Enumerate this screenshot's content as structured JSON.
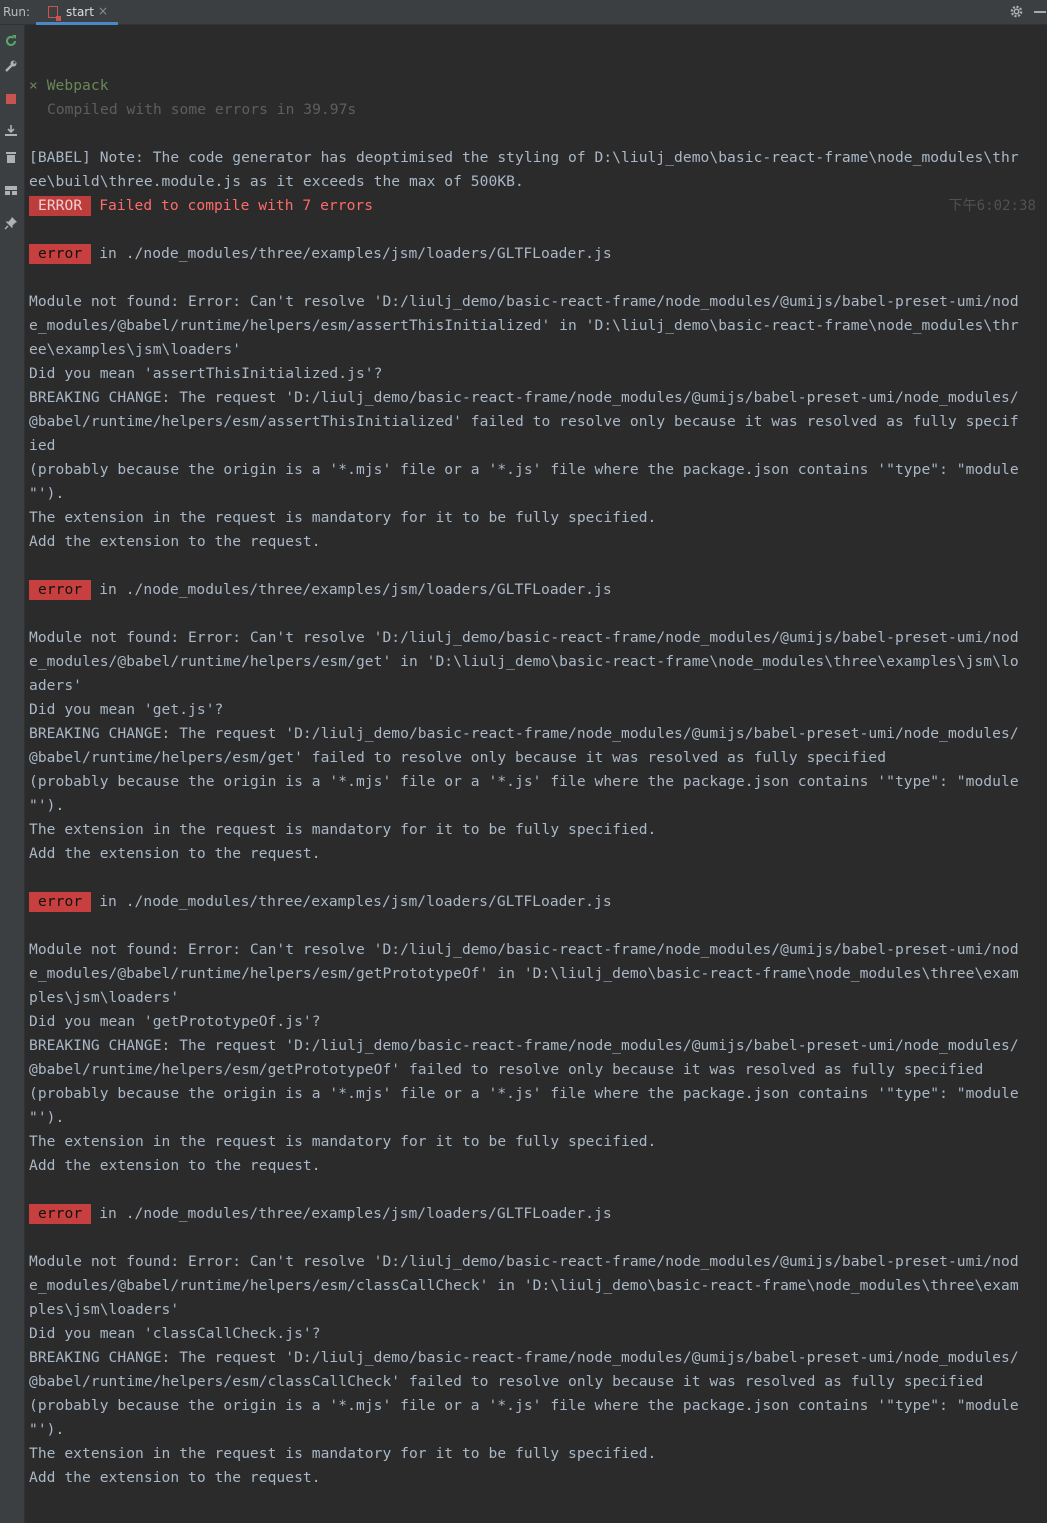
{
  "toolbar": {
    "run_label": "Run:",
    "tab_label": "start",
    "tab_close": "×"
  },
  "icons": {
    "tab": "npm-run-icon",
    "settings": "gear-icon",
    "minimize": "minimize-icon",
    "sidebar": [
      "rerun-icon",
      "wrench-icon",
      "stop-icon",
      "scroll-to-end-icon",
      "trash-icon",
      "layout-icon",
      "pin-icon"
    ]
  },
  "colors": {
    "accent_tab": "#4a88c7",
    "error_badge": "#bd3d3d",
    "error_text": "#ff6b68",
    "success_green": "#6a8759"
  },
  "console": {
    "webpack_mark": "×",
    "webpack_title": "Webpack",
    "compiled": "Compiled with some errors in 39.97s",
    "babel_note_1": "[BABEL] Note: The code generator has deoptimised the styling of D:\\liulj_demo\\basic-react-frame\\node_modules\\thr",
    "babel_note_2": "ee\\build\\three.module.js as it exceeds the max of 500KB.",
    "error_badge": "ERROR",
    "error_summary": "Failed to compile with 7 errors",
    "timestamp": "下午6:02:38",
    "errors": [
      {
        "badge": "error",
        "location": "in ./node_modules/three/examples/jsm/loaders/GLTFLoader.js",
        "lines": [
          "Module not found: Error: Can't resolve 'D:/liulj_demo/basic-react-frame/node_modules/@umijs/babel-preset-umi/nod",
          "e_modules/@babel/runtime/helpers/esm/assertThisInitialized' in 'D:\\liulj_demo\\basic-react-frame\\node_modules\\thr",
          "ee\\examples\\jsm\\loaders'",
          "Did you mean 'assertThisInitialized.js'?",
          "BREAKING CHANGE: The request 'D:/liulj_demo/basic-react-frame/node_modules/@umijs/babel-preset-umi/node_modules/",
          "@babel/runtime/helpers/esm/assertThisInitialized' failed to resolve only because it was resolved as fully specif",
          "ied",
          "(probably because the origin is a '*.mjs' file or a '*.js' file where the package.json contains '\"type\": \"module",
          "\"').",
          "The extension in the request is mandatory for it to be fully specified.",
          "Add the extension to the request."
        ]
      },
      {
        "badge": "error",
        "location": "in ./node_modules/three/examples/jsm/loaders/GLTFLoader.js",
        "lines": [
          "Module not found: Error: Can't resolve 'D:/liulj_demo/basic-react-frame/node_modules/@umijs/babel-preset-umi/nod",
          "e_modules/@babel/runtime/helpers/esm/get' in 'D:\\liulj_demo\\basic-react-frame\\node_modules\\three\\examples\\jsm\\lo",
          "aders'",
          "Did you mean 'get.js'?",
          "BREAKING CHANGE: The request 'D:/liulj_demo/basic-react-frame/node_modules/@umijs/babel-preset-umi/node_modules/",
          "@babel/runtime/helpers/esm/get' failed to resolve only because it was resolved as fully specified",
          "(probably because the origin is a '*.mjs' file or a '*.js' file where the package.json contains '\"type\": \"module",
          "\"').",
          "The extension in the request is mandatory for it to be fully specified.",
          "Add the extension to the request."
        ]
      },
      {
        "badge": "error",
        "location": "in ./node_modules/three/examples/jsm/loaders/GLTFLoader.js",
        "lines": [
          "Module not found: Error: Can't resolve 'D:/liulj_demo/basic-react-frame/node_modules/@umijs/babel-preset-umi/nod",
          "e_modules/@babel/runtime/helpers/esm/getPrototypeOf' in 'D:\\liulj_demo\\basic-react-frame\\node_modules\\three\\exam",
          "ples\\jsm\\loaders'",
          "Did you mean 'getPrototypeOf.js'?",
          "BREAKING CHANGE: The request 'D:/liulj_demo/basic-react-frame/node_modules/@umijs/babel-preset-umi/node_modules/",
          "@babel/runtime/helpers/esm/getPrototypeOf' failed to resolve only because it was resolved as fully specified",
          "(probably because the origin is a '*.mjs' file or a '*.js' file where the package.json contains '\"type\": \"module",
          "\"').",
          "The extension in the request is mandatory for it to be fully specified.",
          "Add the extension to the request."
        ]
      },
      {
        "badge": "error",
        "location": "in ./node_modules/three/examples/jsm/loaders/GLTFLoader.js",
        "lines": [
          "Module not found: Error: Can't resolve 'D:/liulj_demo/basic-react-frame/node_modules/@umijs/babel-preset-umi/nod",
          "e_modules/@babel/runtime/helpers/esm/classCallCheck' in 'D:\\liulj_demo\\basic-react-frame\\node_modules\\three\\exam",
          "ples\\jsm\\loaders'",
          "Did you mean 'classCallCheck.js'?",
          "BREAKING CHANGE: The request 'D:/liulj_demo/basic-react-frame/node_modules/@umijs/babel-preset-umi/node_modules/",
          "@babel/runtime/helpers/esm/classCallCheck' failed to resolve only because it was resolved as fully specified",
          "(probably because the origin is a '*.mjs' file or a '*.js' file where the package.json contains '\"type\": \"module",
          "\"').",
          "The extension in the request is mandatory for it to be fully specified.",
          "Add the extension to the request."
        ]
      }
    ]
  }
}
